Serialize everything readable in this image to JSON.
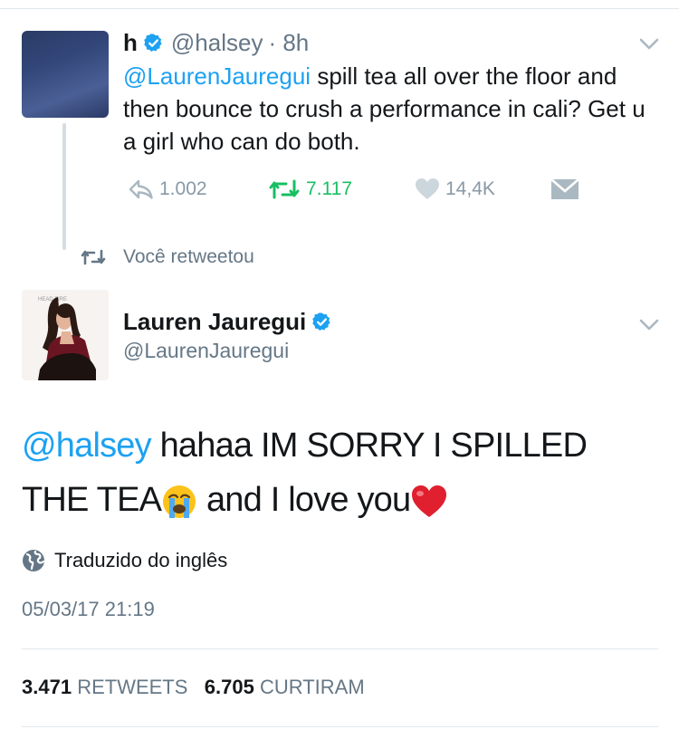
{
  "tweet1": {
    "name": "h",
    "handle": "@halsey",
    "time": "· 8h",
    "mention": "@LaurenJauregui",
    "text": " spill tea all over the floor and then bounce to crush a performance in cali? Get u a girl who can do both.",
    "reply_count": "1.002",
    "retweet_count": "7.117",
    "like_count": "14,4K",
    "retweeted": true,
    "retweet_color": "#17bf63"
  },
  "retweet_context": "Você retweetou",
  "tweet2": {
    "name": "Lauren Jauregui",
    "handle": "@LaurenJauregui",
    "avatar_text": "HEAD ... FIRE",
    "mention": "@halsey",
    "text_a": " hahaa IM SORRY I SPILLED THE TEA",
    "text_b": " and I love you",
    "translation_note": "Traduzido do inglês",
    "timestamp": "05/03/17 21:19",
    "retweets_count": "3.471",
    "retweets_label": "RETWEETS",
    "likes_count": "6.705",
    "likes_label": "CURTIRAM"
  },
  "colors": {
    "accent": "#1da1f2",
    "muted": "#657786",
    "divider": "#e1e8ed"
  }
}
